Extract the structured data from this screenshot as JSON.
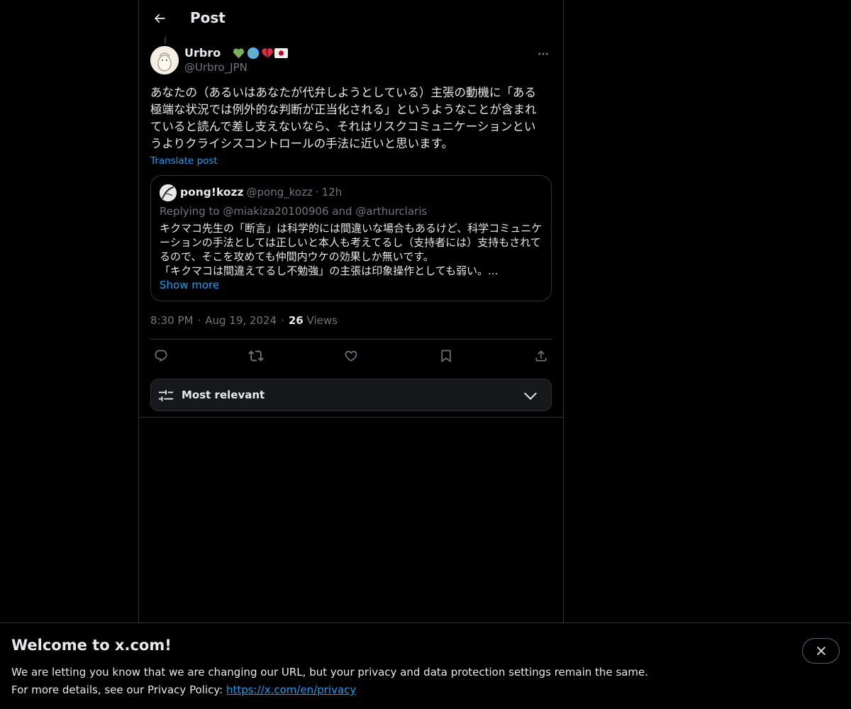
{
  "header": {
    "title": "Post"
  },
  "post": {
    "display_name": "Urbro",
    "handle": "@Urbro_JPN",
    "text_lines": [
      "あなたの（あるいはあなたが代弁しようとしている）主張の動機に「ある",
      "極端な状況では例外的な判断が正当化される」というようなことが含まれ",
      "ていると読んで差し支えないなら、それはリスクコミュニケーションとい",
      "うよりクライシスコントロールの手法に近いと思います。"
    ],
    "translate_label": "Translate post",
    "time": "8:30 PM",
    "date": "Aug 19, 2024",
    "views_count": "26",
    "views_label": "Views"
  },
  "quote": {
    "display_name": "pong!kozz",
    "handle": "@pong_kozz",
    "age": "12h",
    "replying_to": "Replying to @miakiza20100906 and @arthurclaris",
    "text_lines": [
      "キクマコ先生の「断言」は科学的には間違いな場合もあるけど、科学コミュニケ",
      "ーションの手法としては正しいと本人も考えてるし（支持者には）支持もされて",
      "るので、そこを攻めても仲間内ウケの効果しか無いです。",
      "「キクマコは間違えてるし不勉強」の主張は印象操作としても弱い。..."
    ],
    "show_more": "Show more"
  },
  "sort": {
    "label": "Most relevant"
  },
  "banner": {
    "title": "Welcome to x.com!",
    "line1": "We are letting you know that we are changing our URL, but your privacy and data protection settings remain the same.",
    "line2_prefix": "For more details, see our Privacy Policy: ",
    "link": "https://x.com/en/privacy"
  },
  "colors": {
    "accent": "#1d9bf0",
    "background": "#000000",
    "muted": "#71767b",
    "border": "#2f3336"
  },
  "icons": [
    "back-arrow-icon",
    "more-icon",
    "reply-icon",
    "repost-icon",
    "like-icon",
    "bookmark-icon",
    "share-icon",
    "sort-sliders-icon",
    "chevron-down-icon",
    "close-icon"
  ]
}
